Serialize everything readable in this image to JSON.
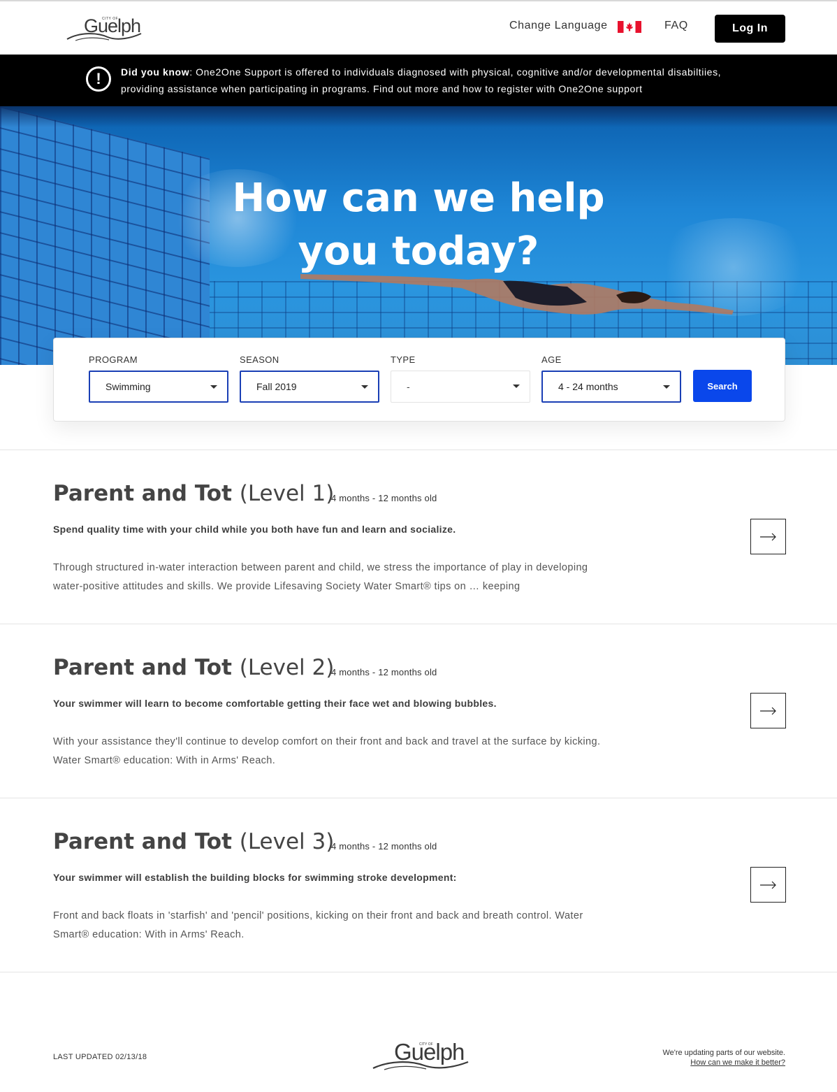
{
  "header": {
    "logo_small": "CITY OF",
    "logo_word": "Guelph",
    "change_language": "Change Language",
    "flag_icon": "canada-flag-icon",
    "faq": "FAQ",
    "login": "Log In"
  },
  "notice": {
    "icon": "alert-icon",
    "lead": "Did you know",
    "text": ": One2One Support is offered to individuals diagnosed with physical, cognitive and/or developmental disabiltiies, providing assistance when participating in programs. Find out more and how to register with One2One support"
  },
  "hero": {
    "line1": "How can we help",
    "line2": "you today?"
  },
  "search": {
    "program_label": "PROGRAM",
    "program_value": "Swimming",
    "season_label": "SEASON",
    "season_value": "Fall 2019",
    "type_label": "TYPE",
    "type_value": "-",
    "age_label": "AGE",
    "age_value": "4 - 24 months",
    "button": "Search"
  },
  "results": [
    {
      "title": "Parent and Tot",
      "level": "(Level 1)",
      "age": "4 months - 12 months old",
      "lead": "Spend quality time with your child while you both have fun and learn and socialize.",
      "body": "Through structured in-water interaction between parent and child, we stress the importance of play in developing water-positive attitudes and skills. We provide Lifesaving Society Water Smart® tips on … keeping"
    },
    {
      "title": "Parent and Tot",
      "level": "(Level 2)",
      "age": "4 months - 12 months old",
      "lead": "Your swimmer will learn to become comfortable getting their face wet and blowing bubbles.",
      "body": "With your assistance they'll continue to develop comfort on their front and back and travel at the surface by kicking. Water Smart® education: With in Arms' Reach."
    },
    {
      "title": "Parent and Tot",
      "level": "(Level 3)",
      "age": "4 months - 12 months old",
      "lead": "Your swimmer will establish the building blocks for swimming stroke development:",
      "body": "Front and back floats in 'starfish' and 'pencil' positions, kicking on their front and back and breath control. Water Smart® education: With in Arms' Reach."
    }
  ],
  "footer": {
    "last_updated": "LAST UPDATED 02/13/18",
    "logo_small": "CITY OF",
    "logo_word": "Guelph",
    "updating": "We're updating parts of our website.",
    "feedback_link": "How can we make it better?"
  },
  "colors": {
    "accent": "#0a47eb",
    "select_border": "#1a3fb5",
    "notice_bg": "#000000",
    "flag_red": "#e8112d"
  }
}
